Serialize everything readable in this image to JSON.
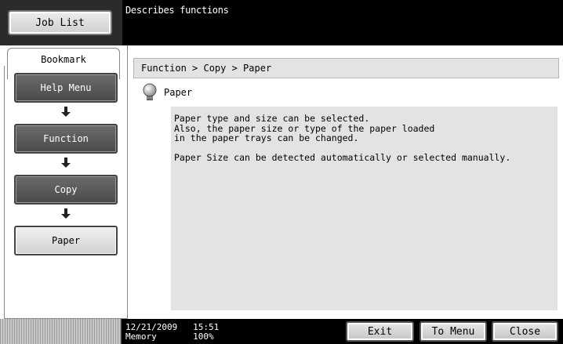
{
  "header": {
    "job_list_label": "Job List",
    "message": "Describes functions"
  },
  "bookmark": {
    "tab_label": "Bookmark",
    "items": [
      {
        "label": "Help Menu"
      },
      {
        "label": "Function"
      },
      {
        "label": "Copy"
      },
      {
        "label": "Paper"
      }
    ]
  },
  "main": {
    "breadcrumb": "Function > Copy > Paper",
    "title": "Paper",
    "description_lines": [
      "Paper type and size can be selected.",
      "Also, the paper size or type of the paper loaded",
      "in the paper trays can be changed.",
      "Paper Size can be detected automatically or selected manually."
    ]
  },
  "status": {
    "datetime": "12/21/2009   15:51",
    "memory": "Memory       100%"
  },
  "footer": {
    "exit_label": "Exit",
    "to_menu_label": "To Menu",
    "close_label": "Close"
  },
  "colors": {
    "header_bg": "#000000",
    "dark_button": "#555555",
    "light_panel": "#e3e3e3"
  },
  "icons": [
    "arrow-down-icon",
    "lightbulb-icon"
  ]
}
